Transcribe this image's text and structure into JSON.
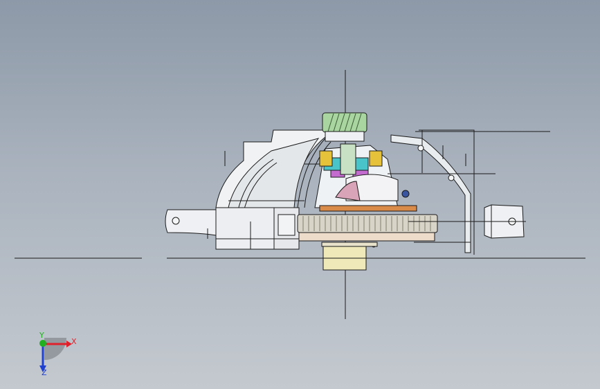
{
  "triad": {
    "x_label": "X",
    "y_label": "Y",
    "z_label": "Z"
  },
  "colors": {
    "background_top": "#8d99a8",
    "background_bottom": "#c4c9cf",
    "line": "#1a1a1a",
    "part_fill": "#eef0f3",
    "gear_green": "#a9d6a0",
    "ring_gear": "#d9d4c8",
    "shaft_yellow": "#efe8b8",
    "axis_x": "#e0202a",
    "axis_y": "#20b020",
    "axis_z": "#2040d0"
  }
}
